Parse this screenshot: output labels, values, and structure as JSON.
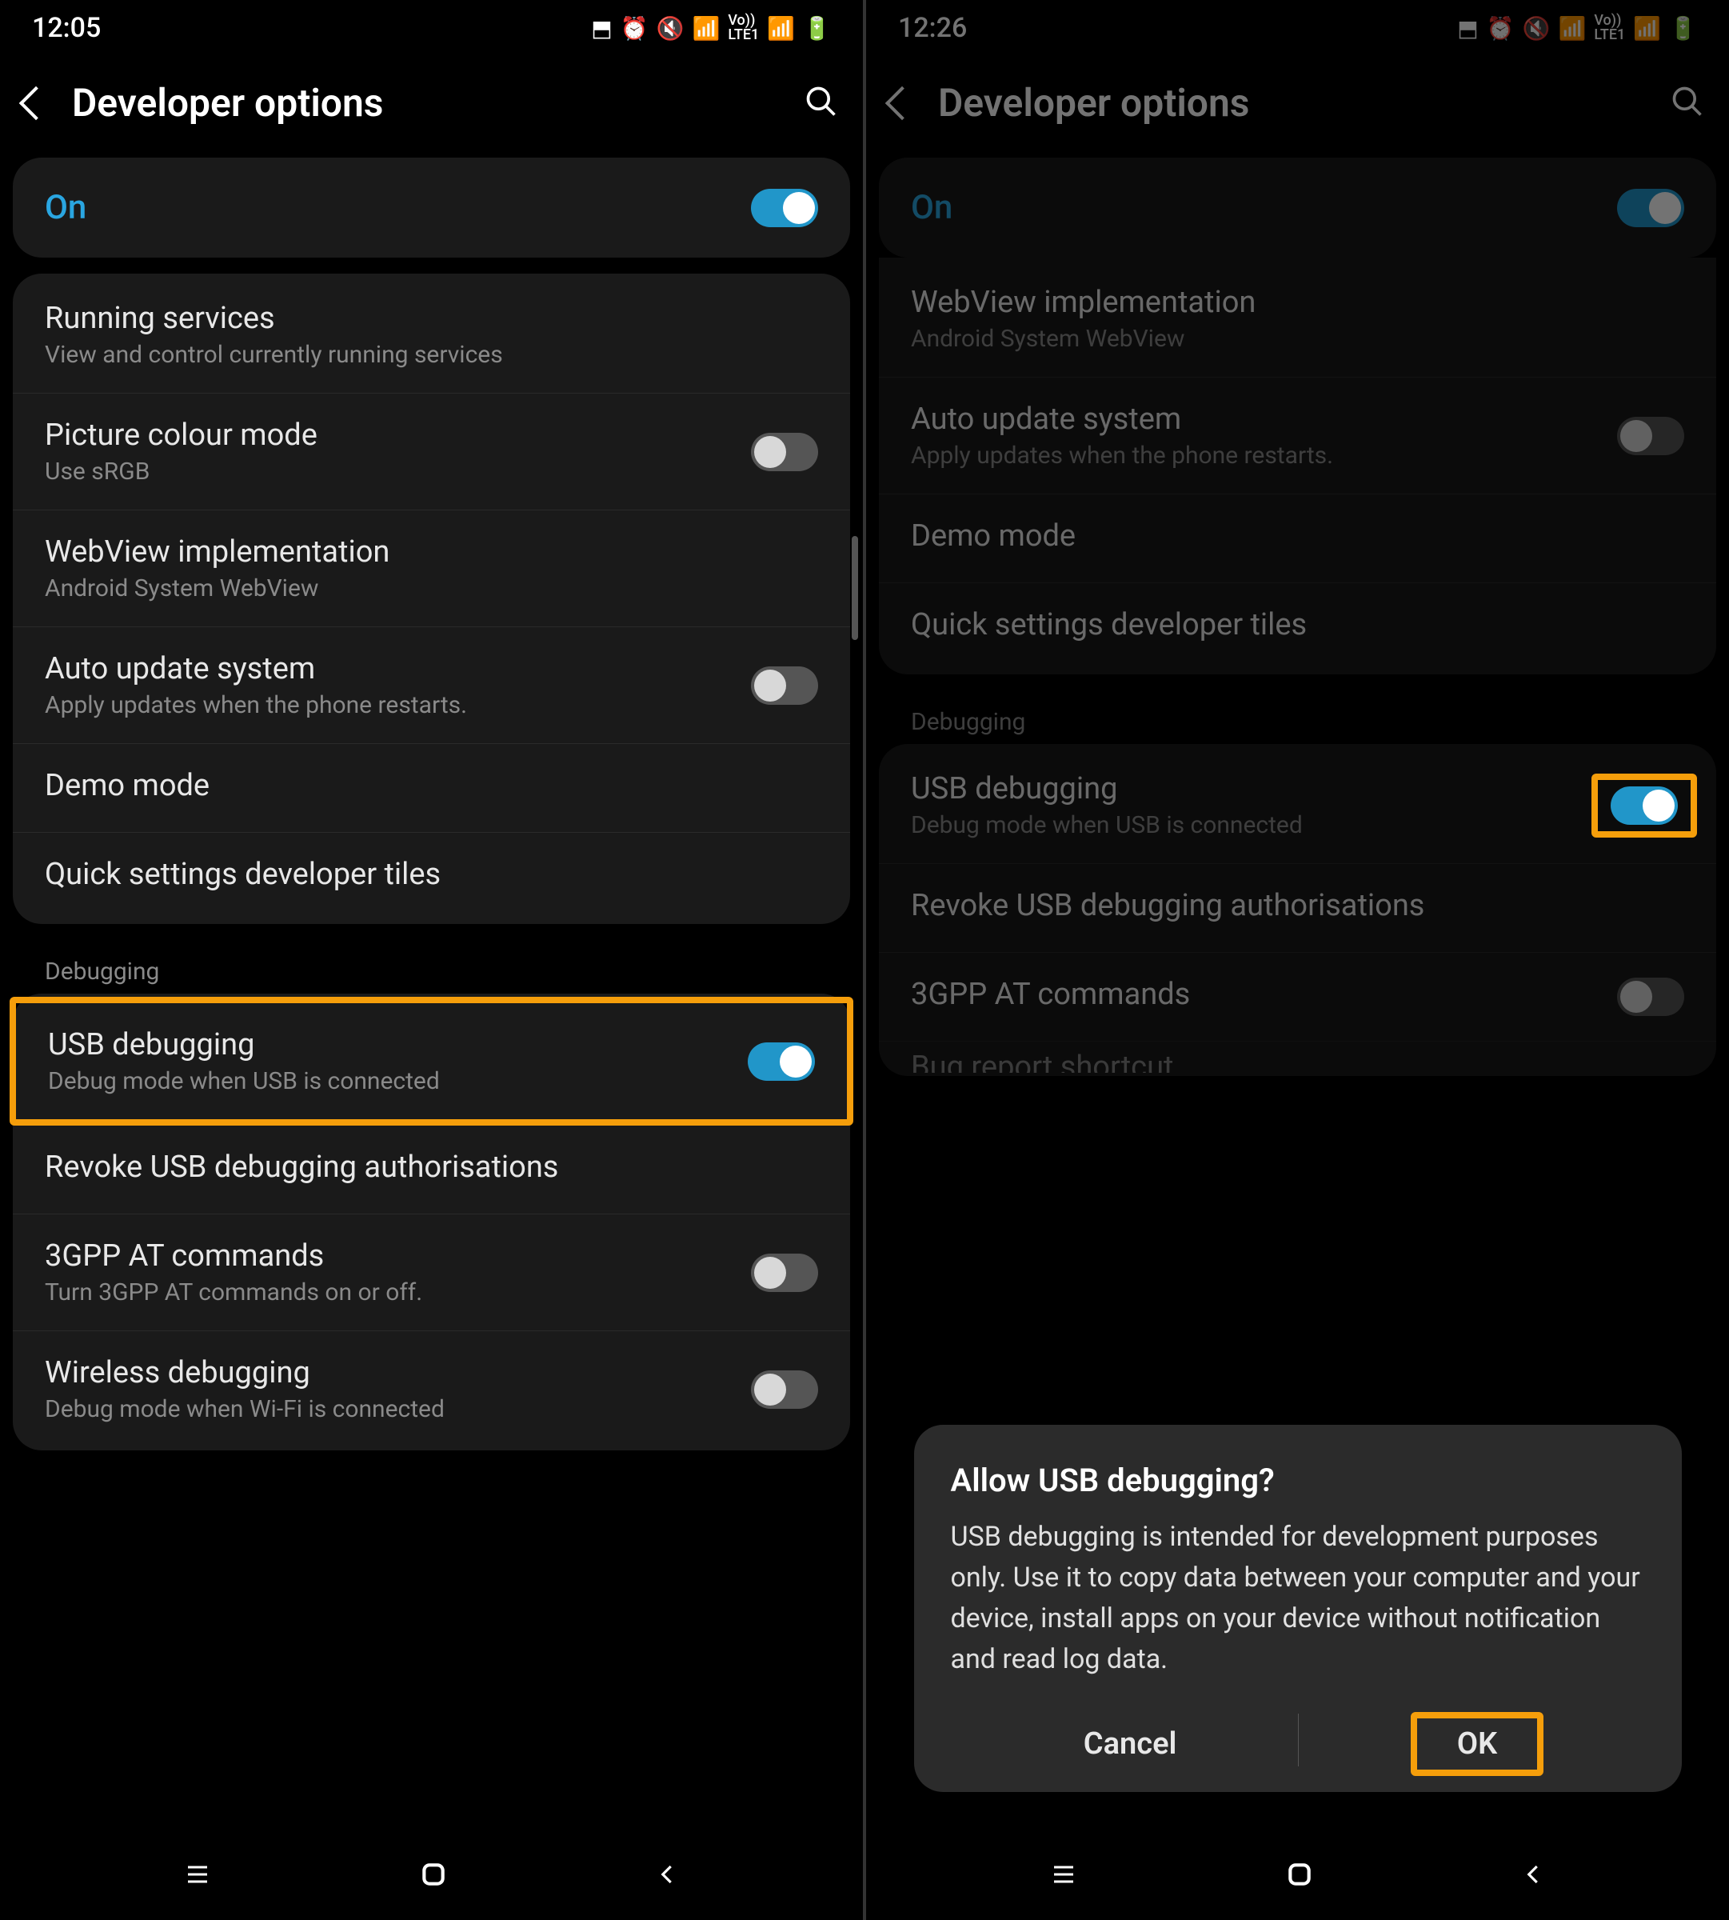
{
  "left": {
    "status": {
      "time": "12:05"
    },
    "header": {
      "title": "Developer options"
    },
    "master": {
      "label": "On",
      "on": true
    },
    "section1": [
      {
        "title": "Running services",
        "sub": "View and control currently running services",
        "toggle": null
      },
      {
        "title": "Picture colour mode",
        "sub": "Use sRGB",
        "toggle": false
      },
      {
        "title": "WebView implementation",
        "sub": "Android System WebView",
        "toggle": null
      },
      {
        "title": "Auto update system",
        "sub": "Apply updates when the phone restarts.",
        "toggle": false
      },
      {
        "title": "Demo mode",
        "sub": "",
        "toggle": null
      },
      {
        "title": "Quick settings developer tiles",
        "sub": "",
        "toggle": null
      }
    ],
    "section_label": "Debugging",
    "section2": [
      {
        "title": "USB debugging",
        "sub": "Debug mode when USB is connected",
        "toggle": true,
        "highlight": true
      },
      {
        "title": "Revoke USB debugging authorisations",
        "sub": "",
        "toggle": null
      },
      {
        "title": "3GPP AT commands",
        "sub": "Turn 3GPP AT commands on or off.",
        "toggle": false
      },
      {
        "title": "Wireless debugging",
        "sub": "Debug mode when Wi-Fi is connected",
        "toggle": false
      }
    ]
  },
  "right": {
    "status": {
      "time": "12:26"
    },
    "header": {
      "title": "Developer options"
    },
    "master": {
      "label": "On",
      "on": true
    },
    "section1": [
      {
        "title": "WebView implementation",
        "sub": "Android System WebView",
        "toggle": null
      },
      {
        "title": "Auto update system",
        "sub": "Apply updates when the phone restarts.",
        "toggle": false
      },
      {
        "title": "Demo mode",
        "sub": "",
        "toggle": null
      },
      {
        "title": "Quick settings developer tiles",
        "sub": "",
        "toggle": null
      }
    ],
    "section_label": "Debugging",
    "section2": [
      {
        "title": "USB debugging",
        "sub": "Debug mode when USB is connected",
        "toggle": true,
        "toggle_highlight": true
      },
      {
        "title": "Revoke USB debugging authorisations",
        "sub": "",
        "toggle": null
      },
      {
        "title": "3GPP AT commands",
        "sub": "",
        "toggle": false
      },
      {
        "title": "Bug report shortcut",
        "sub": "",
        "toggle": null,
        "cutoff": true
      }
    ],
    "dialog": {
      "title": "Allow USB debugging?",
      "body": "USB debugging is intended for development purposes only. Use it to copy data between your computer and your device, install apps on your device without notification and read log data.",
      "cancel": "Cancel",
      "ok": "OK"
    }
  },
  "status_network": "LTE1"
}
